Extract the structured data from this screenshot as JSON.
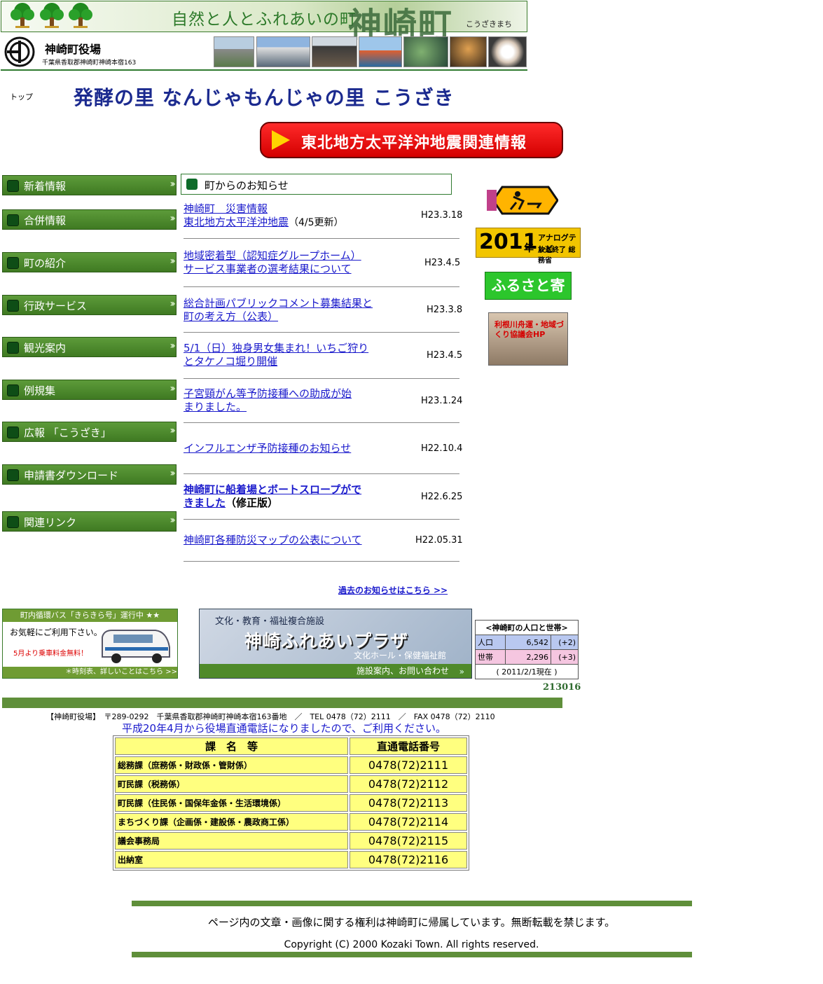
{
  "header": {
    "slogan": "自然と人とふれあいの町",
    "town_name": "神崎町",
    "town_kana": "こうざきまち",
    "office_name": "神崎町役場",
    "office_address": "千葉県香取郡神崎町神崎本宿163"
  },
  "breadcrumb": {
    "top": "トップ"
  },
  "hero_slogan": "発酵の里 なんじゃもんじゃの里 こうざき",
  "quake_button": {
    "label": "東北地方太平洋沖地震関連情報"
  },
  "nav": {
    "items": [
      "新着情報",
      "合併情報",
      "町の紹介",
      "行政サービス",
      "観光案内",
      "例規集",
      "広報 「こうざき」",
      "申請書ダウンロード",
      "関連リンク"
    ]
  },
  "notices": {
    "heading": "町からのお知らせ",
    "items": [
      {
        "line1": "神崎町　災害情報",
        "line2": "東北地方太平洋沖地震",
        "suffix": "（4/5更新）",
        "date": "H23.3.18"
      },
      {
        "line1": "地域密着型（認知症グループホーム）",
        "line2": "サービス事業者の選考結果について",
        "date": "H23.4.5"
      },
      {
        "line1": "総合計画パブリックコメント募集結果と",
        "line2": "町の考え方（公表）",
        "date": "H23.3.8"
      },
      {
        "line1": "5/1（日）独身男女集まれ！いちご狩り",
        "line2": "とタケノコ堀り開催",
        "date": "H23.4.5"
      },
      {
        "line1": "子宮頸がん等予防接種への助成が始",
        "line2": "まりました。",
        "date": "H23.1.24"
      },
      {
        "line1": "インフルエンザ予防接種のお知らせ",
        "date": "H22.10.4"
      },
      {
        "line1": "神崎町に船着場とボートスロープがで",
        "line2": "きました",
        "suffix": "（修正版）",
        "date": "H22.6.25"
      },
      {
        "line1": "神崎町各種防災マップの公表について",
        "date": "H22.05.31"
      }
    ],
    "past_link": "過去のお知らせはこちら >>"
  },
  "side_banners": {
    "tv": {
      "year": "2011",
      "nen": "年",
      "line1": "アナログテレビ",
      "line2": "放送終了 総務省"
    },
    "furusato": "ふるさと寄附金",
    "tonegawa": "利根川舟運・地域づくり協議会HP"
  },
  "bus_banner": {
    "head": "町内循環バス「きらきら号」運行中 ★★",
    "text1": "お気軽にご利用下さい。",
    "text2": "5月より乗車料金無料！",
    "foot": "＊時刻表、詳しいことはこちら >>"
  },
  "plaza_banner": {
    "sub": "文化・教育・福祉複合施設",
    "title": "神崎ふれあいプラザ",
    "sub2": "文化ホール・保健福祉館",
    "foot": "施設案内、お問い合わせ"
  },
  "population": {
    "title": "<神崎町の人口と世帯>",
    "rows": [
      {
        "label": "人口",
        "value": "6,542",
        "change": "(+2)"
      },
      {
        "label": "世帯",
        "value": "2,296",
        "change": "(+3)"
      }
    ],
    "as_of": "( 2011/2/1現在 )"
  },
  "counter": "213016",
  "footer": {
    "address": "【神崎町役場】　〒289-0292　千葉県香取郡神崎町神崎本宿163番地　／　TEL 0478（72）2111　／　FAX 0478（72）2110",
    "phone_note": "平成20年4月から役場直通電話になりましたので、ご利用ください。",
    "phone_table": {
      "headers": [
        "課　名　等",
        "直通電話番号"
      ],
      "rows": [
        [
          "総務課（庶務係・財政係・管財係）",
          "0478(72)2111"
        ],
        [
          "町民課（税務係）",
          "0478(72)2112"
        ],
        [
          "町民課（住民係・国保年金係・生活環境係）",
          "0478(72)2113"
        ],
        [
          "まちづくり課（企画係・建設係・農政商工係）",
          "0478(72)2114"
        ],
        [
          "議会事務局",
          "0478(72)2115"
        ],
        [
          "出納室",
          "0478(72)2116"
        ]
      ]
    },
    "copyright_ja": "ページ内の文章・画像に関する権利は神崎町に帰属しています。無断転載を禁じます。",
    "copyright_en": "Copyright (C) 2000 Kozaki Town. All rights reserved."
  },
  "colors": {
    "nav_green": "#4f8a2c",
    "link_blue": "#1a1acc",
    "quake_red": "#e00000",
    "table_yellow": "#ffff7f"
  }
}
